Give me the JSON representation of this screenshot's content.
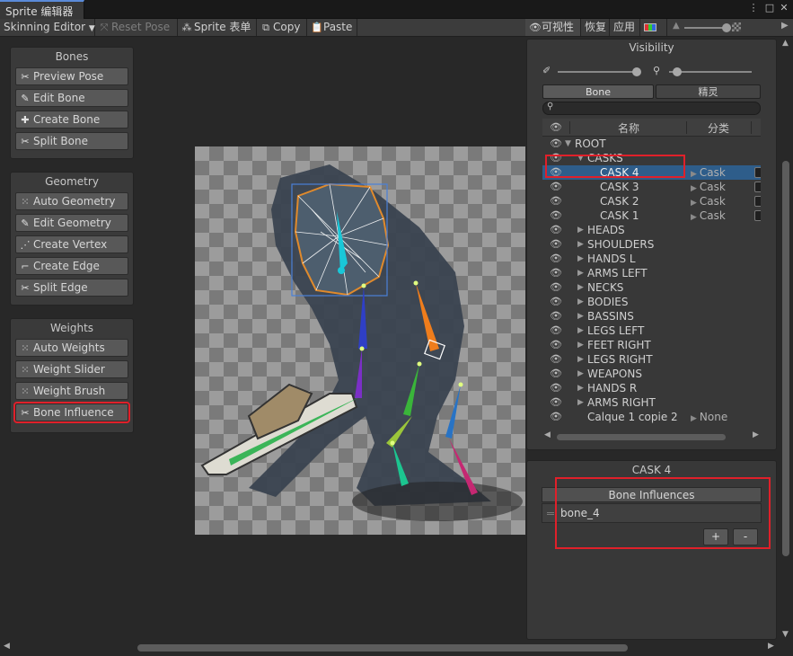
{
  "window": {
    "tab_title": "Sprite 编辑器"
  },
  "toolbar": {
    "mode_label": "Skinning Editor",
    "reset_pose": "Reset Pose",
    "sprite_sheet": "Sprite 表单",
    "copy": "Copy",
    "paste": "Paste",
    "visibility": "可视性",
    "revert": "恢复",
    "apply": "应用"
  },
  "bones_panel": {
    "title": "Bones",
    "buttons": [
      "Preview Pose",
      "Edit Bone",
      "Create Bone",
      "Split Bone"
    ]
  },
  "geometry_panel": {
    "title": "Geometry",
    "buttons": [
      "Auto Geometry",
      "Edit Geometry",
      "Create Vertex",
      "Create Edge",
      "Split Edge"
    ]
  },
  "weights_panel": {
    "title": "Weights",
    "buttons": [
      "Auto Weights",
      "Weight Slider",
      "Weight Brush",
      "Bone Influence"
    ]
  },
  "visibility_panel": {
    "title": "Visibility",
    "tabs": [
      "Bone",
      "精灵"
    ],
    "columns": {
      "name": "名称",
      "category": "分类"
    },
    "rows": [
      {
        "name": "ROOT",
        "depth": 0,
        "arrow": "▼",
        "category": "",
        "selected": false
      },
      {
        "name": "CASKS",
        "depth": 1,
        "arrow": "▼",
        "category": "",
        "selected": false
      },
      {
        "name": "CASK 4",
        "depth": 2,
        "arrow": "",
        "category": "Cask",
        "selected": true
      },
      {
        "name": "CASK 3",
        "depth": 2,
        "arrow": "",
        "category": "Cask",
        "selected": false
      },
      {
        "name": "CASK 2",
        "depth": 2,
        "arrow": "",
        "category": "Cask",
        "selected": false
      },
      {
        "name": "CASK 1",
        "depth": 2,
        "arrow": "",
        "category": "Cask",
        "selected": false
      },
      {
        "name": "HEADS",
        "depth": 1,
        "arrow": "▶",
        "category": "",
        "selected": false
      },
      {
        "name": "SHOULDERS",
        "depth": 1,
        "arrow": "▶",
        "category": "",
        "selected": false
      },
      {
        "name": "HANDS L",
        "depth": 1,
        "arrow": "▶",
        "category": "",
        "selected": false
      },
      {
        "name": "ARMS LEFT",
        "depth": 1,
        "arrow": "▶",
        "category": "",
        "selected": false
      },
      {
        "name": "NECKS",
        "depth": 1,
        "arrow": "▶",
        "category": "",
        "selected": false
      },
      {
        "name": "BODIES",
        "depth": 1,
        "arrow": "▶",
        "category": "",
        "selected": false
      },
      {
        "name": "BASSINS",
        "depth": 1,
        "arrow": "▶",
        "category": "",
        "selected": false
      },
      {
        "name": "LEGS LEFT",
        "depth": 1,
        "arrow": "▶",
        "category": "",
        "selected": false
      },
      {
        "name": "FEET RIGHT",
        "depth": 1,
        "arrow": "▶",
        "category": "",
        "selected": false
      },
      {
        "name": "LEGS RIGHT",
        "depth": 1,
        "arrow": "▶",
        "category": "",
        "selected": false
      },
      {
        "name": "WEAPONS",
        "depth": 1,
        "arrow": "▶",
        "category": "",
        "selected": false
      },
      {
        "name": "HANDS R",
        "depth": 1,
        "arrow": "▶",
        "category": "",
        "selected": false
      },
      {
        "name": "ARMS RIGHT",
        "depth": 1,
        "arrow": "▶",
        "category": "",
        "selected": false
      },
      {
        "name": "Calque 1 copie 2",
        "depth": 1,
        "arrow": "",
        "category": "None",
        "selected": false
      }
    ]
  },
  "influence_panel": {
    "title": "CASK 4",
    "header": "Bone Influences",
    "items": [
      "bone_4"
    ],
    "add": "+",
    "remove": "-"
  },
  "colors": {
    "accent_selection": "#2e5d8a",
    "highlight_box": "#e0202a"
  }
}
